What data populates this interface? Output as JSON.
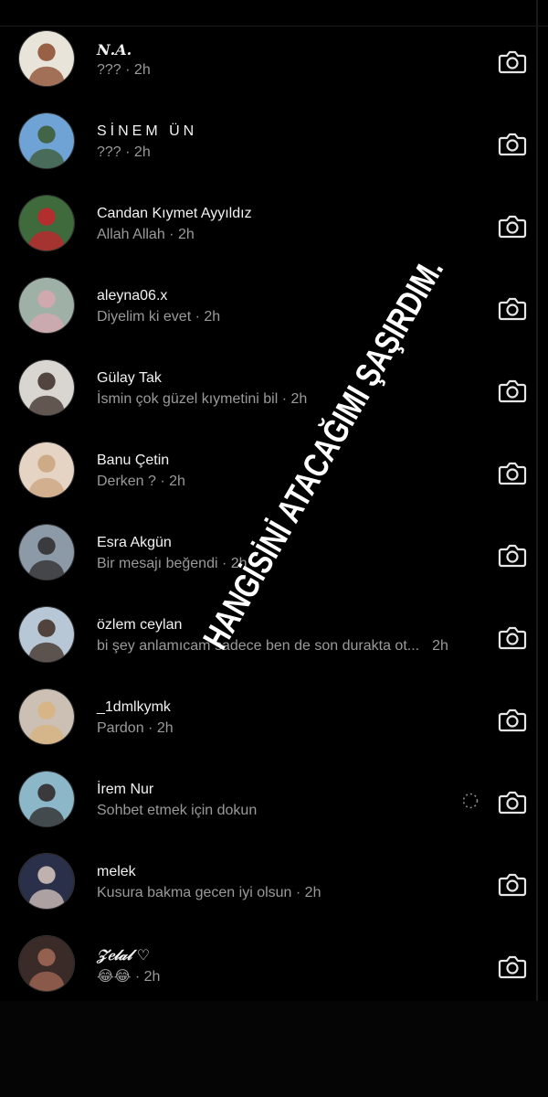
{
  "threads": [
    {
      "name": "𝑵.𝑨.",
      "preview": "??? · 2h",
      "avatar": {
        "bg": "#e9e4da",
        "fg": "#8a4a2a"
      }
    },
    {
      "name": "SİNEM ÜN",
      "preview": "??? · 2h",
      "avatar": {
        "bg": "#6fa3d6",
        "fg": "#3b5a2f"
      }
    },
    {
      "name": "Candan Kıymet Ayyıldız",
      "preview": "Allah Allah · 2h",
      "avatar": {
        "bg": "#3f6a3c",
        "fg": "#c8232d"
      }
    },
    {
      "name": "aleyna06.x",
      "preview": "Diyelim ki evet · 2h",
      "avatar": {
        "bg": "#9fb1a6",
        "fg": "#d8a8b0"
      }
    },
    {
      "name": "Gülay Tak",
      "preview": "İsmin çok güzel kıymetini bil · 2h",
      "avatar": {
        "bg": "#d9d6d2",
        "fg": "#3a2b26"
      }
    },
    {
      "name": "Banu Çetin",
      "preview": "Derken ? · 2h",
      "avatar": {
        "bg": "#e5d3c4",
        "fg": "#c9a37d"
      }
    },
    {
      "name": "Esra Akgün",
      "preview": "Bir mesajı beğendi · 2h",
      "avatar": {
        "bg": "#8c9aa8",
        "fg": "#2d2a2a"
      }
    },
    {
      "name": "özlem ceylan",
      "preview": "bi şey anlamıcam sadece ben de son durakta ot...",
      "preview_time": "2h",
      "avatar": {
        "bg": "#b8c7d6",
        "fg": "#3d2c22"
      }
    },
    {
      "name": "_1dmlkymk",
      "preview": "Pardon · 2h",
      "avatar": {
        "bg": "#ccbfb4",
        "fg": "#d8b37e"
      }
    },
    {
      "name": "İrem Nur",
      "preview": "Sohbet etmek için dokun",
      "avatar": {
        "bg": "#8bb7c9",
        "fg": "#2b2524"
      },
      "loading": true
    },
    {
      "name": "melek",
      "preview": "Kusura bakma gecen iyi olsun · 2h",
      "avatar": {
        "bg": "#2a2f4a",
        "fg": "#d9c8c0"
      }
    },
    {
      "name": "𝒵𝑒𝓁𝒶𝓁 ♡",
      "preview": "😂😂 · 2h",
      "avatar": {
        "bg": "#3a2a28",
        "fg": "#a56a56"
      }
    }
  ],
  "overlay_text": "HANGİSİNİ ATACAĞIMI ŞAŞIRDIM.",
  "icons": {
    "camera": "camera-icon",
    "loading": "loading-spinner-icon"
  },
  "colors": {
    "background": "#000000",
    "name": "#f2f2f2",
    "preview": "#9a9a9a",
    "icon": "#e6e6e6"
  }
}
